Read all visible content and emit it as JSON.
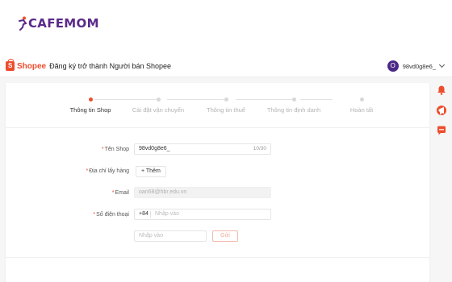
{
  "brand": {
    "name": "CAFEMOM"
  },
  "header": {
    "shopee_logo_text": "Shopee",
    "title": "Đăng ký trở thành Người bán Shopee",
    "account": {
      "avatar_initial": "O",
      "name": "98vd0g8e6_"
    }
  },
  "steps": [
    {
      "label": "Thông tin Shop",
      "active": true
    },
    {
      "label": "Cài đặt vận chuyển",
      "active": false
    },
    {
      "label": "Thông tin thuế",
      "active": false
    },
    {
      "label": "Thông tin định danh",
      "active": false
    },
    {
      "label": "Hoàn tất",
      "active": false
    }
  ],
  "form": {
    "shop_name": {
      "label": "Tên Shop",
      "value": "98vd0g8e6_",
      "count": "10/30"
    },
    "pickup_address": {
      "label": "Địa chỉ lấy hàng",
      "button": "+ Thêm"
    },
    "email": {
      "label": "Email",
      "value": "oan68@hbr.edu.vn"
    },
    "phone": {
      "label": "Số điện thoại",
      "prefix": "+84",
      "placeholder": "Nhập vào"
    },
    "otp": {
      "placeholder": "Nhập vào",
      "button": "Gửi"
    }
  },
  "side_icons": [
    "bell-icon",
    "megaphone-icon",
    "chat-icon"
  ],
  "colors": {
    "accent": "#ee4d2d",
    "brand_purple": "#5a2a8a",
    "avatar": "#4b2a86"
  }
}
